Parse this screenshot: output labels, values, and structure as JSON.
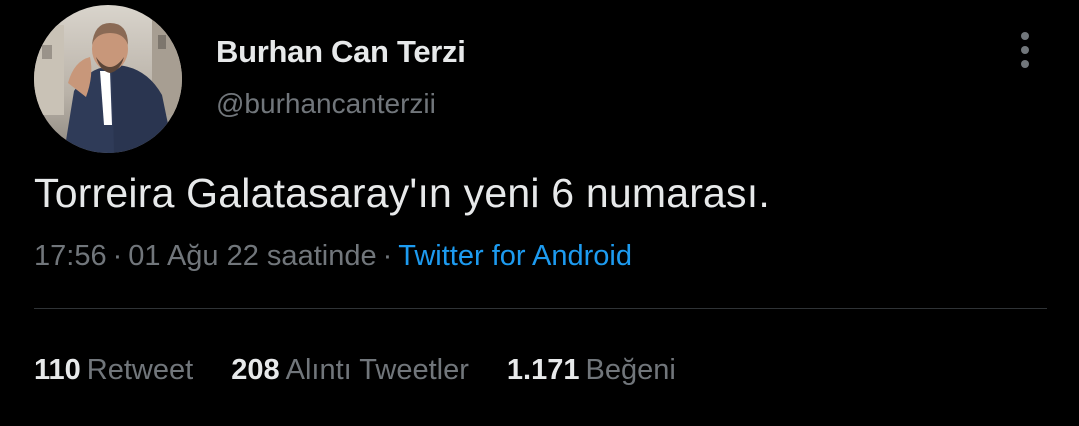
{
  "author": {
    "display_name": "Burhan Can Terzi",
    "handle": "@burhancanterzii",
    "avatar_icon": "profile-photo"
  },
  "menu": {
    "icon": "more-vertical-icon"
  },
  "tweet": {
    "text": "Torreira Galatasaray'ın yeni 6 numarası."
  },
  "meta": {
    "time": "17:56",
    "separator": "·",
    "date": "01 Ağu 22 saatinde",
    "source": "Twitter for Android"
  },
  "stats": [
    {
      "count": "110",
      "label": "Retweet"
    },
    {
      "count": "208",
      "label": "Alıntı Tweetler"
    },
    {
      "count": "1.171",
      "label": "Beğeni"
    }
  ],
  "colors": {
    "background": "#000000",
    "text": "#e7e9ea",
    "secondary": "#71767b",
    "link": "#1d9bf0",
    "divider": "#2f3336"
  }
}
